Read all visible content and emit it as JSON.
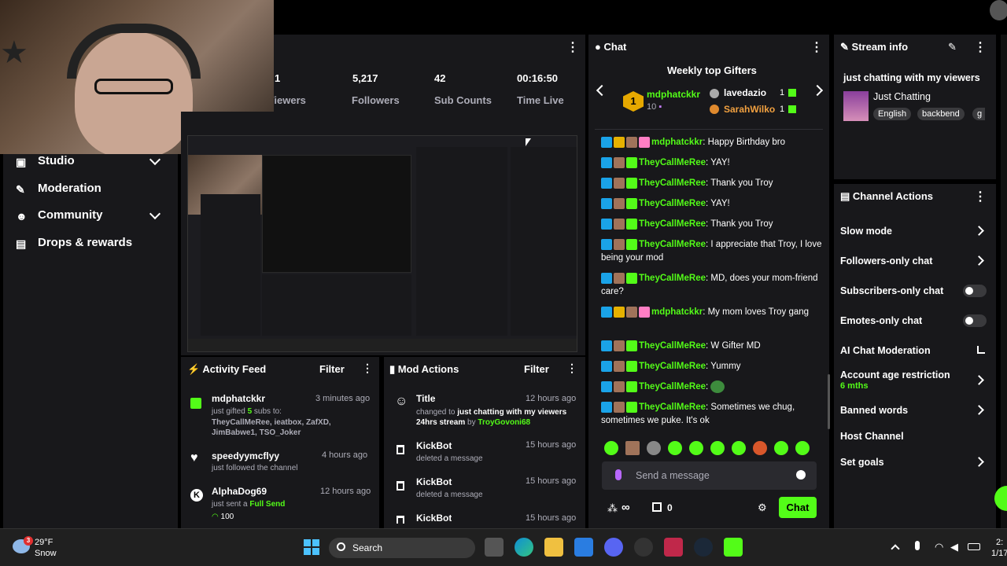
{
  "sidebar": {
    "items": [
      {
        "label": "Studio"
      },
      {
        "label": "Moderation"
      },
      {
        "label": "Community"
      },
      {
        "label": "Drops & rewards"
      }
    ]
  },
  "stats": [
    {
      "value": "1",
      "label": "Viewers"
    },
    {
      "value": "5,217",
      "label": "Followers"
    },
    {
      "value": "42",
      "label": "Sub Counts"
    },
    {
      "value": "00:16:50",
      "label": "Time Live"
    }
  ],
  "activity_feed": {
    "title": "Activity Feed",
    "filter_label": "Filter",
    "items": [
      {
        "name": "mdphatckkr",
        "time": "3 minutes ago",
        "text_a": "just gifted ",
        "count": "5",
        "text_b": " subs to:",
        "recipients": "TheyCallMeRee, ieatbox, ZafXD, JimBabwe1, TSO_Joker"
      },
      {
        "name": "speedyymcflyy",
        "time": "4 hours ago",
        "text": "just followed the channel"
      },
      {
        "name": "AlphaDog69",
        "time": "12 hours ago",
        "text": "just sent a ",
        "highlight": "Full Send",
        "amount": "100"
      }
    ]
  },
  "mod_actions": {
    "title": "Mod Actions",
    "filter_label": "Filter",
    "items": [
      {
        "name": "Title",
        "time": "12 hours ago",
        "text_a": "changed to ",
        "bold": "just chatting with my viewers 24hrs stream",
        "text_b": " by ",
        "by": "TroyGovoni68"
      },
      {
        "name": "KickBot",
        "time": "15 hours ago",
        "text": "deleted a message"
      },
      {
        "name": "KickBot",
        "time": "15 hours ago",
        "text": "deleted a message"
      },
      {
        "name": "KickBot",
        "time": "15 hours ago",
        "text": ""
      }
    ]
  },
  "chat": {
    "title": "Chat",
    "gifters_title": "Weekly top Gifters",
    "top_gifter": {
      "rank": "1",
      "name": "mdphatckkr",
      "count": "10"
    },
    "gifters": [
      {
        "name": "lavedazio",
        "count": "1"
      },
      {
        "name": "SarahWilko",
        "count": "1"
      }
    ],
    "messages": [
      {
        "user": "mdphatckkr",
        "text": "Happy Birthday bro"
      },
      {
        "user": "TheyCallMeRee",
        "text": "YAY!"
      },
      {
        "user": "TheyCallMeRee",
        "text": "Thank you Troy"
      },
      {
        "user": "TheyCallMeRee",
        "text": "YAY!"
      },
      {
        "user": "TheyCallMeRee",
        "text": "Thank you Troy"
      },
      {
        "user": "TheyCallMeRee",
        "text": "I appreciate that Troy, I love being your mod"
      },
      {
        "user": "TheyCallMeRee",
        "text": "MD, does your mom-friend care?"
      },
      {
        "user": "mdphatckkr",
        "text": "My mom loves Troy gang"
      },
      {
        "user": "TheyCallMeRee",
        "text": "W Gifter MD"
      },
      {
        "user": "TheyCallMeRee",
        "text": "Yummy"
      },
      {
        "user": "TheyCallMeRee",
        "text": ""
      },
      {
        "user": "TheyCallMeRee",
        "text": "Sometimes we chug, sometimes we puke. It's ok"
      }
    ],
    "input_placeholder": "Send a message",
    "send_label": "Chat",
    "infinity_label": "∞",
    "points": "0"
  },
  "stream_info": {
    "title": "Stream info",
    "stream_title": "just chatting with my viewers",
    "category": "Just Chatting",
    "tags": [
      "English",
      "backbend",
      "g"
    ]
  },
  "channel_actions": {
    "title": "Channel Actions",
    "items": [
      {
        "label": "Slow mode"
      },
      {
        "label": "Followers-only chat"
      },
      {
        "label": "Subscribers-only chat"
      },
      {
        "label": "Emotes-only chat"
      },
      {
        "label": "AI Chat Moderation"
      },
      {
        "label": "Account age restriction",
        "sub": "6 mths"
      },
      {
        "label": "Banned words"
      },
      {
        "label": "Host Channel"
      },
      {
        "label": "Set goals"
      }
    ]
  },
  "taskbar": {
    "weather_temp": "29°F",
    "weather_cond": "Snow",
    "weather_badge": "3",
    "search_label": "Search",
    "clock_time": "2:",
    "clock_date": "1/17"
  },
  "colors": {
    "accent": "#53fc18",
    "panel": "#18181b",
    "background": "#000000"
  }
}
